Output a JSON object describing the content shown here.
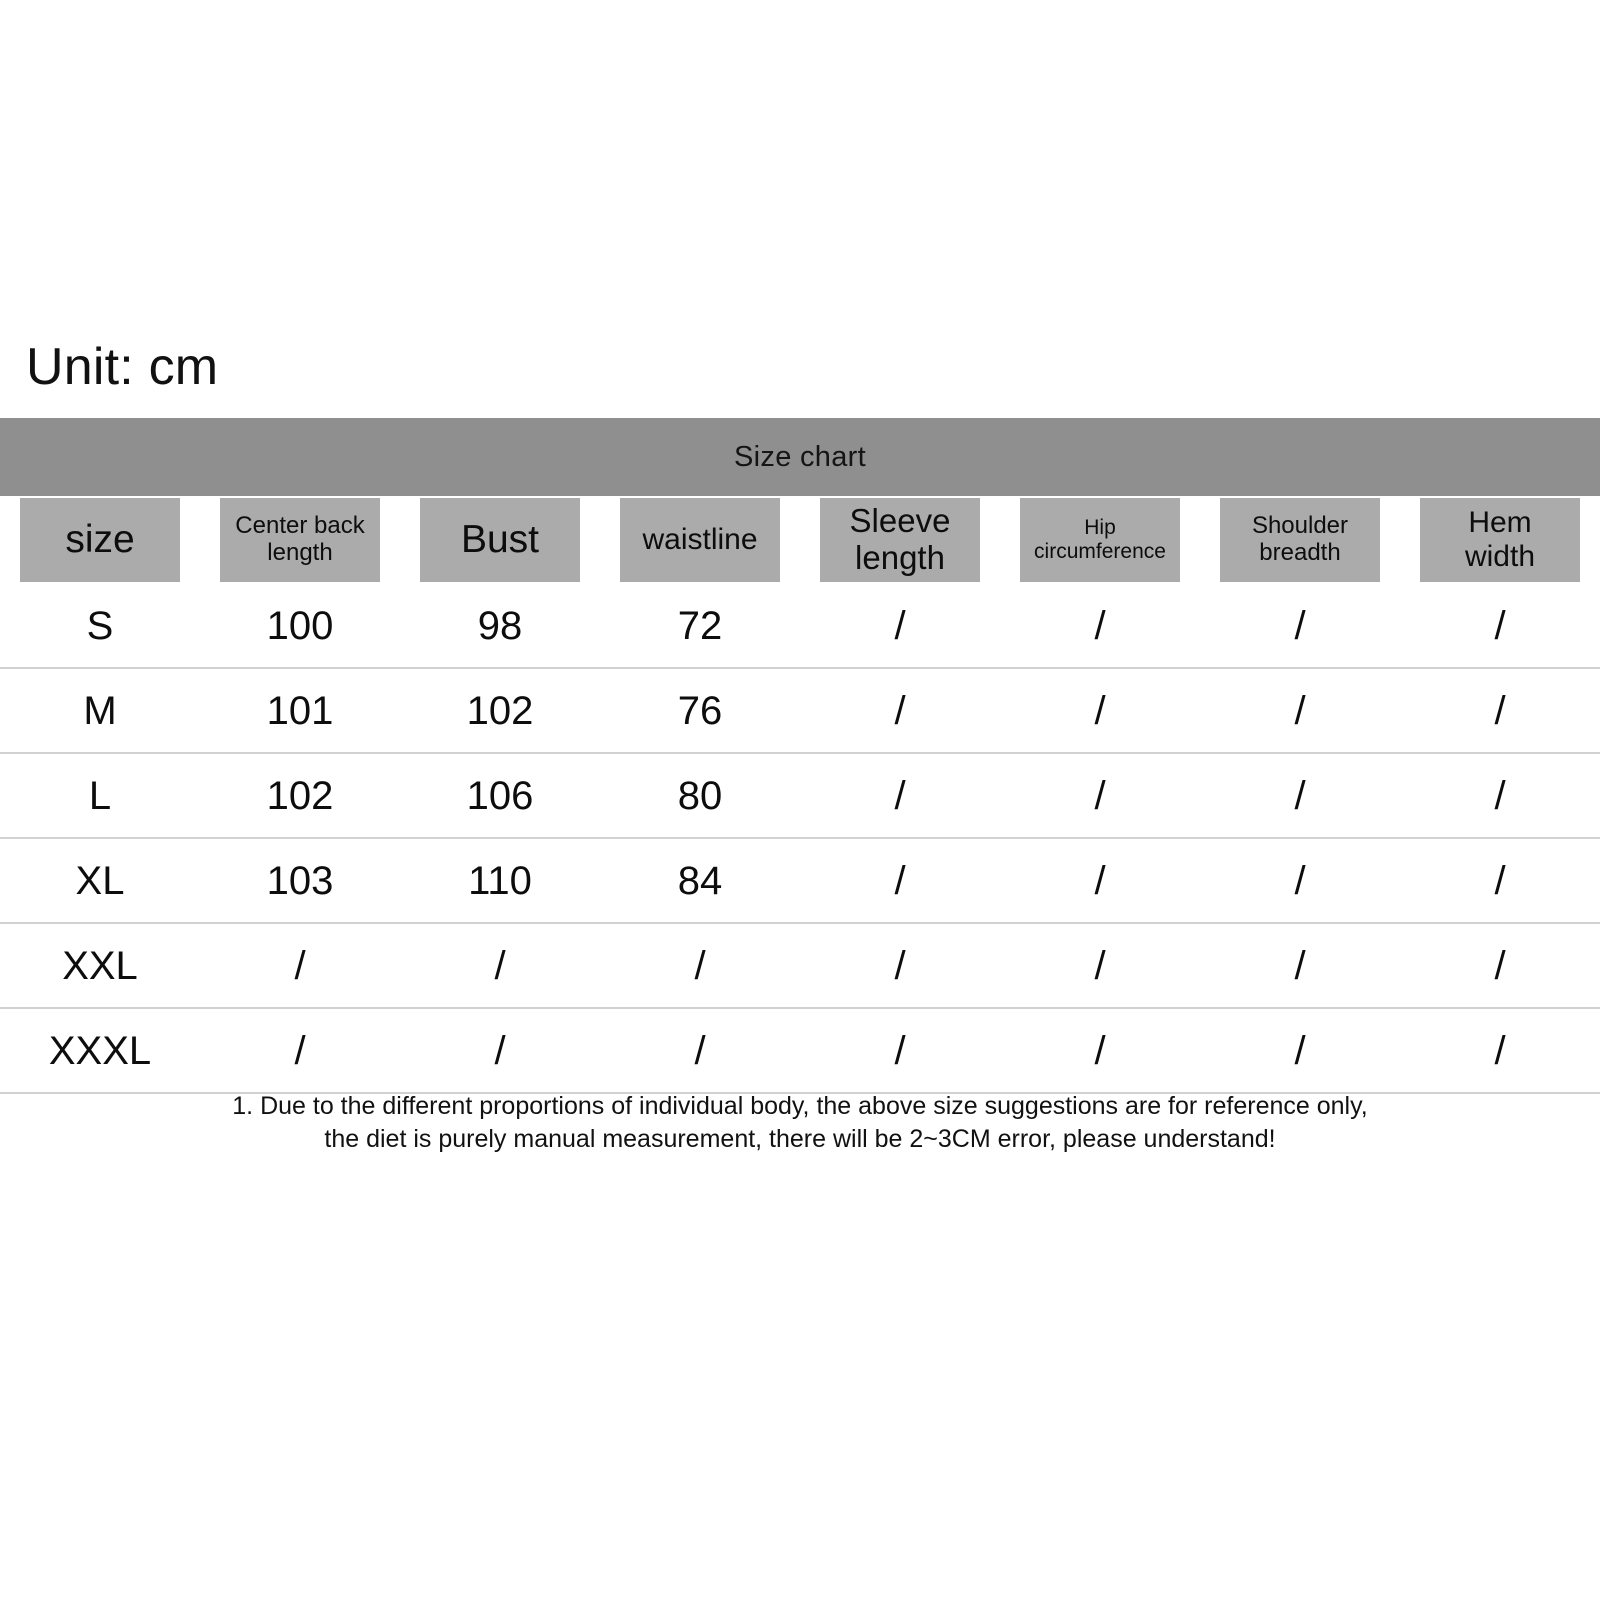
{
  "unit_label": "Unit: cm",
  "table": {
    "title": "Size chart",
    "columns": [
      {
        "label": "size",
        "size_class": "hdr-xl"
      },
      {
        "label": "Center back\nlength",
        "size_class": "hdr-sm"
      },
      {
        "label": "Bust",
        "size_class": "hdr-xl"
      },
      {
        "label": "waistline",
        "size_class": "hdr-md"
      },
      {
        "label": "Sleeve\nlength",
        "size_class": "hdr-lg"
      },
      {
        "label": "Hip\ncircumference",
        "size_class": "hdr-xs"
      },
      {
        "label": "Shoulder\nbreadth",
        "size_class": "hdr-sm"
      },
      {
        "label": "Hem\nwidth",
        "size_class": "hdr-md"
      }
    ],
    "column_headers_flat": [
      "size",
      "Center back length",
      "Bust",
      "waistline",
      "Sleeve length",
      "Hip circumference",
      "Shoulder breadth",
      "Hem width"
    ],
    "rows": [
      {
        "size": "S",
        "center_back_length": "100",
        "bust": "98",
        "waistline": "72",
        "sleeve_length": "/",
        "hip_circumference": "/",
        "shoulder_breadth": "/",
        "hem_width": "/"
      },
      {
        "size": "M",
        "center_back_length": "101",
        "bust": "102",
        "waistline": "76",
        "sleeve_length": "/",
        "hip_circumference": "/",
        "shoulder_breadth": "/",
        "hem_width": "/"
      },
      {
        "size": "L",
        "center_back_length": "102",
        "bust": "106",
        "waistline": "80",
        "sleeve_length": "/",
        "hip_circumference": "/",
        "shoulder_breadth": "/",
        "hem_width": "/"
      },
      {
        "size": "XL",
        "center_back_length": "103",
        "bust": "110",
        "waistline": "84",
        "sleeve_length": "/",
        "hip_circumference": "/",
        "shoulder_breadth": "/",
        "hem_width": "/"
      },
      {
        "size": "XXL",
        "center_back_length": "/",
        "bust": "/",
        "waistline": "/",
        "sleeve_length": "/",
        "hip_circumference": "/",
        "shoulder_breadth": "/",
        "hem_width": "/"
      },
      {
        "size": "XXXL",
        "center_back_length": "/",
        "bust": "/",
        "waistline": "/",
        "sleeve_length": "/",
        "hip_circumference": "/",
        "shoulder_breadth": "/",
        "hem_width": "/"
      }
    ]
  },
  "footnote": {
    "line1": "1. Due to the different proportions of individual body, the above size suggestions are for reference only,",
    "line2": "the diet is purely manual measurement, there will be 2~3CM error, please understand!"
  },
  "colors": {
    "title_bar": "#8f8f8f",
    "header_chip": "#ababab",
    "row_rule": "#d2d2d2",
    "background": "#ffffff",
    "text": "#0d0d0d"
  },
  "chart_data": {
    "type": "table",
    "title": "Size chart",
    "unit": "cm",
    "categories": [
      "S",
      "M",
      "L",
      "XL",
      "XXL",
      "XXXL"
    ],
    "columns": [
      "size",
      "Center back length",
      "Bust",
      "waistline",
      "Sleeve length",
      "Hip circumference",
      "Shoulder breadth",
      "Hem width"
    ],
    "series": [
      {
        "name": "Center back length",
        "values": [
          "100",
          "101",
          "102",
          "103",
          "/",
          "/"
        ]
      },
      {
        "name": "Bust",
        "values": [
          "98",
          "102",
          "106",
          "110",
          "/",
          "/"
        ]
      },
      {
        "name": "waistline",
        "values": [
          "72",
          "76",
          "80",
          "84",
          "/",
          "/"
        ]
      },
      {
        "name": "Sleeve length",
        "values": [
          "/",
          "/",
          "/",
          "/",
          "/",
          "/"
        ]
      },
      {
        "name": "Hip circumference",
        "values": [
          "/",
          "/",
          "/",
          "/",
          "/",
          "/"
        ]
      },
      {
        "name": "Shoulder breadth",
        "values": [
          "/",
          "/",
          "/",
          "/",
          "/",
          "/"
        ]
      },
      {
        "name": "Hem width",
        "values": [
          "/",
          "/",
          "/",
          "/",
          "/",
          "/"
        ]
      }
    ]
  }
}
